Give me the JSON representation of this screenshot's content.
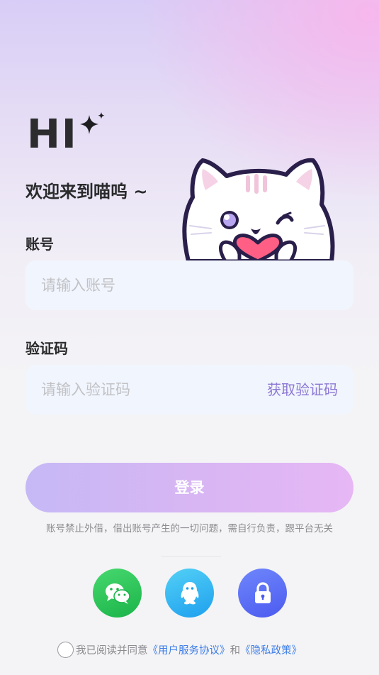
{
  "header": {
    "hi_text": "HI",
    "welcome": "欢迎来到喵呜 ~"
  },
  "account": {
    "label": "账号",
    "placeholder": "请输入账号",
    "value": ""
  },
  "code": {
    "label": "验证码",
    "placeholder": "请输入验证码",
    "value": "",
    "get_code_label": "获取验证码"
  },
  "login": {
    "label": "登录"
  },
  "disclaimer": "账号禁止外借，借出账号产生的一切问题，需自行负责，跟平台无关",
  "social": {
    "items": [
      "wechat-icon",
      "qq-icon",
      "lock-icon"
    ]
  },
  "agreement": {
    "prefix": "我已阅读并同意",
    "terms": "《用户服务协议》",
    "and": "和",
    "privacy": "《隐私政策》",
    "checked": false
  },
  "colors": {
    "accent": "#8c78d4",
    "button_gradient_start": "#c6b8f6",
    "button_gradient_end": "#e6b7f4",
    "link": "#3f7ee8",
    "wechat": "#1ab44a",
    "qq": "#1ea0ee",
    "lock": "#4b5bf0"
  }
}
